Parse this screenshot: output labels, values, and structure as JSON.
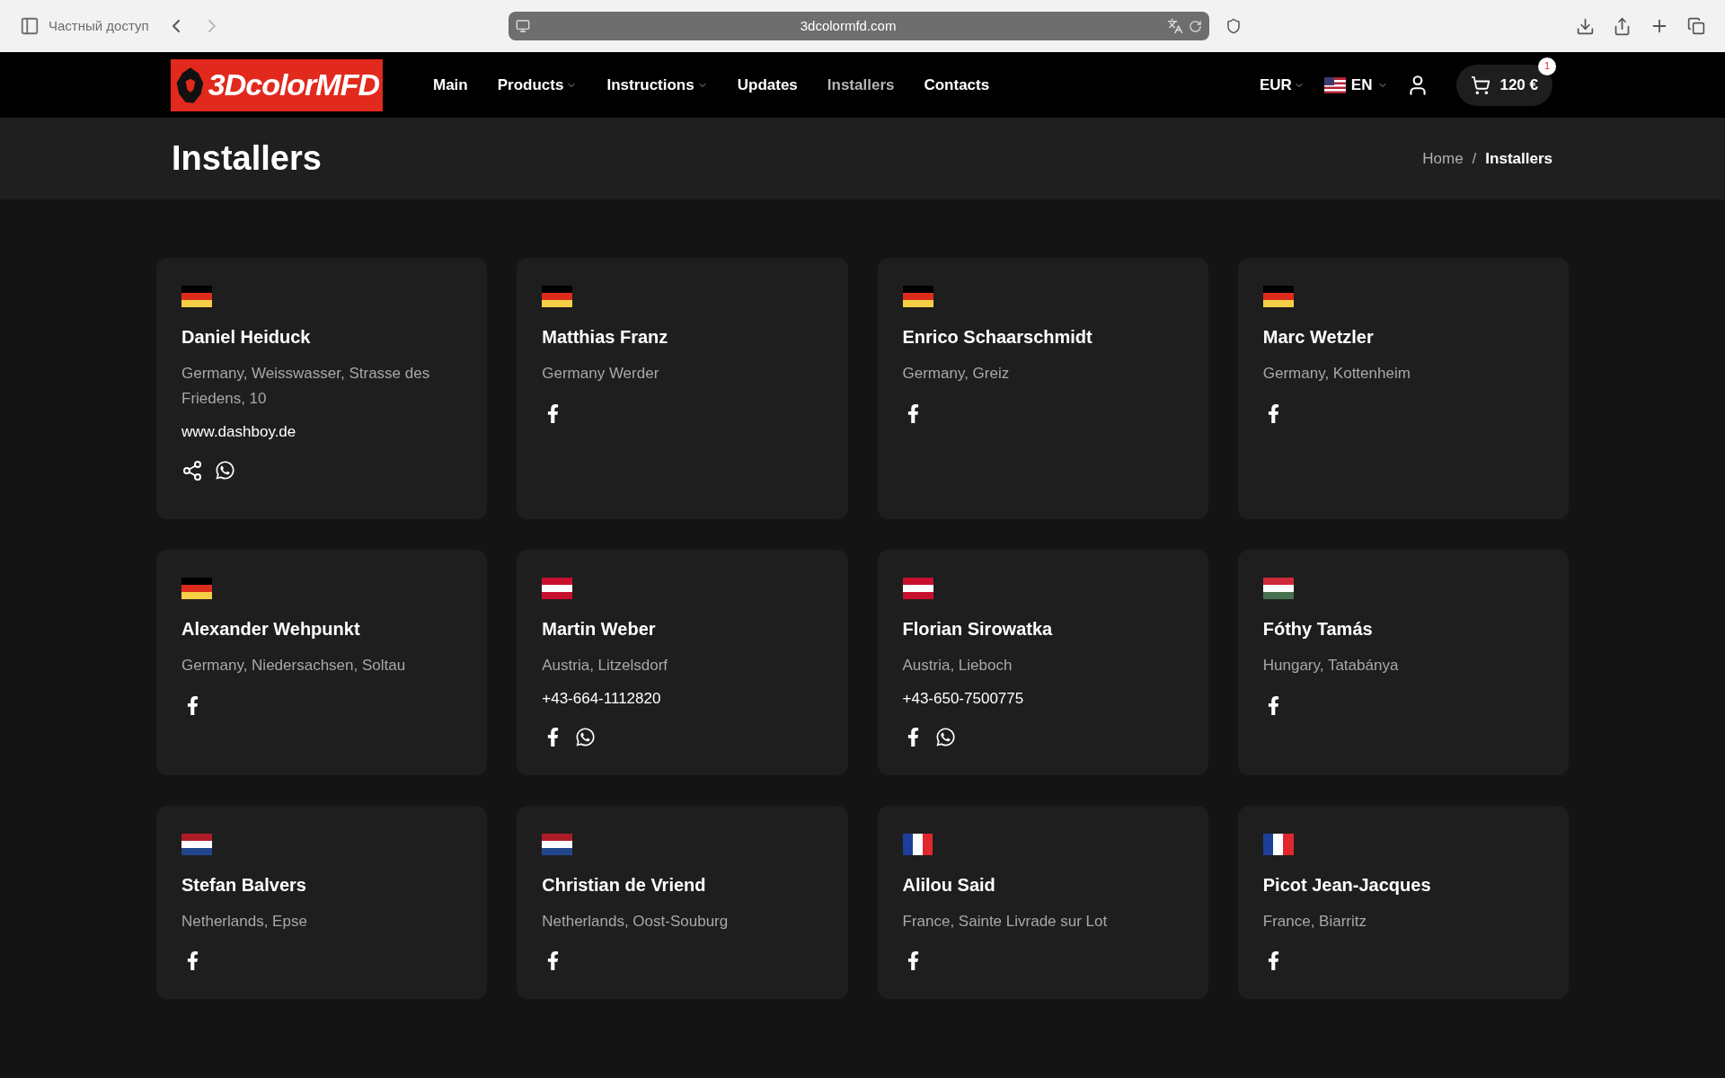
{
  "browser": {
    "sidebar_label": "Частный доступ",
    "url": "3dcolormfd.com"
  },
  "header": {
    "logo": "3DcolorMFD",
    "nav": [
      {
        "label": "Main",
        "selected": false,
        "dropdown": false
      },
      {
        "label": "Products",
        "selected": false,
        "dropdown": true
      },
      {
        "label": "Instructions",
        "selected": false,
        "dropdown": true
      },
      {
        "label": "Updates",
        "selected": false,
        "dropdown": false
      },
      {
        "label": "Installers",
        "selected": true,
        "dropdown": false
      },
      {
        "label": "Contacts",
        "selected": false,
        "dropdown": false
      }
    ],
    "currency": "EUR",
    "language": "EN",
    "cart": {
      "total": "120 €",
      "count": "1"
    }
  },
  "page_title": "Installers",
  "breadcrumb": [
    {
      "label": "Home",
      "selected": false
    },
    {
      "label": "Installers",
      "selected": true
    }
  ],
  "breadcrumb_separator": "/",
  "installers": [
    {
      "flag": {
        "kind": "de"
      },
      "name": "Daniel Heiduck",
      "address": "Germany, Weisswasser, Strasse des Friedens, 10",
      "contact": "www.dashboy.de",
      "social": [
        {
          "kind": "share"
        },
        {
          "kind": "whatsapp"
        }
      ]
    },
    {
      "flag": {
        "kind": "de"
      },
      "name": "Matthias Franz",
      "address": "Germany Werder",
      "social": [
        {
          "kind": "facebook"
        }
      ]
    },
    {
      "flag": {
        "kind": "de"
      },
      "name": "Enrico Schaarschmidt",
      "address": "Germany, Greiz",
      "social": [
        {
          "kind": "facebook"
        }
      ]
    },
    {
      "flag": {
        "kind": "de"
      },
      "name": "Marc Wetzler",
      "address": "Germany, Kottenheim",
      "social": [
        {
          "kind": "facebook"
        }
      ]
    },
    {
      "flag": {
        "kind": "de"
      },
      "name": "Alexander Wehpunkt",
      "address": "Germany, Niedersachsen, Soltau",
      "social": [
        {
          "kind": "facebook"
        }
      ]
    },
    {
      "flag": {
        "kind": "at"
      },
      "name": "Martin Weber",
      "address": "Austria, Litzelsdorf",
      "contact": "+43-664-1112820",
      "social": [
        {
          "kind": "facebook"
        },
        {
          "kind": "whatsapp"
        }
      ]
    },
    {
      "flag": {
        "kind": "at"
      },
      "name": "Florian Sirowatka",
      "address": "Austria, Lieboch",
      "contact": "+43-650-7500775",
      "social": [
        {
          "kind": "facebook"
        },
        {
          "kind": "whatsapp"
        }
      ]
    },
    {
      "flag": {
        "kind": "hu"
      },
      "name": "Fóthy Tamás",
      "address": "Hungary, Tatabánya",
      "social": [
        {
          "kind": "facebook"
        }
      ]
    },
    {
      "flag": {
        "kind": "nl"
      },
      "name": "Stefan Balvers",
      "address": "Netherlands, Epse",
      "social": [
        {
          "kind": "facebook"
        }
      ]
    },
    {
      "flag": {
        "kind": "nl"
      },
      "name": "Christian de Vriend",
      "address": "Netherlands, Oost-Souburg",
      "social": [
        {
          "kind": "facebook"
        }
      ]
    },
    {
      "flag": {
        "kind": "fr"
      },
      "name": "Alilou Said",
      "address": "France, Sainte Livrade sur Lot",
      "social": [
        {
          "kind": "facebook"
        }
      ]
    },
    {
      "flag": {
        "kind": "fr"
      },
      "name": "Picot Jean-Jacques",
      "address": "France, Biarritz",
      "social": [
        {
          "kind": "facebook"
        }
      ]
    }
  ]
}
